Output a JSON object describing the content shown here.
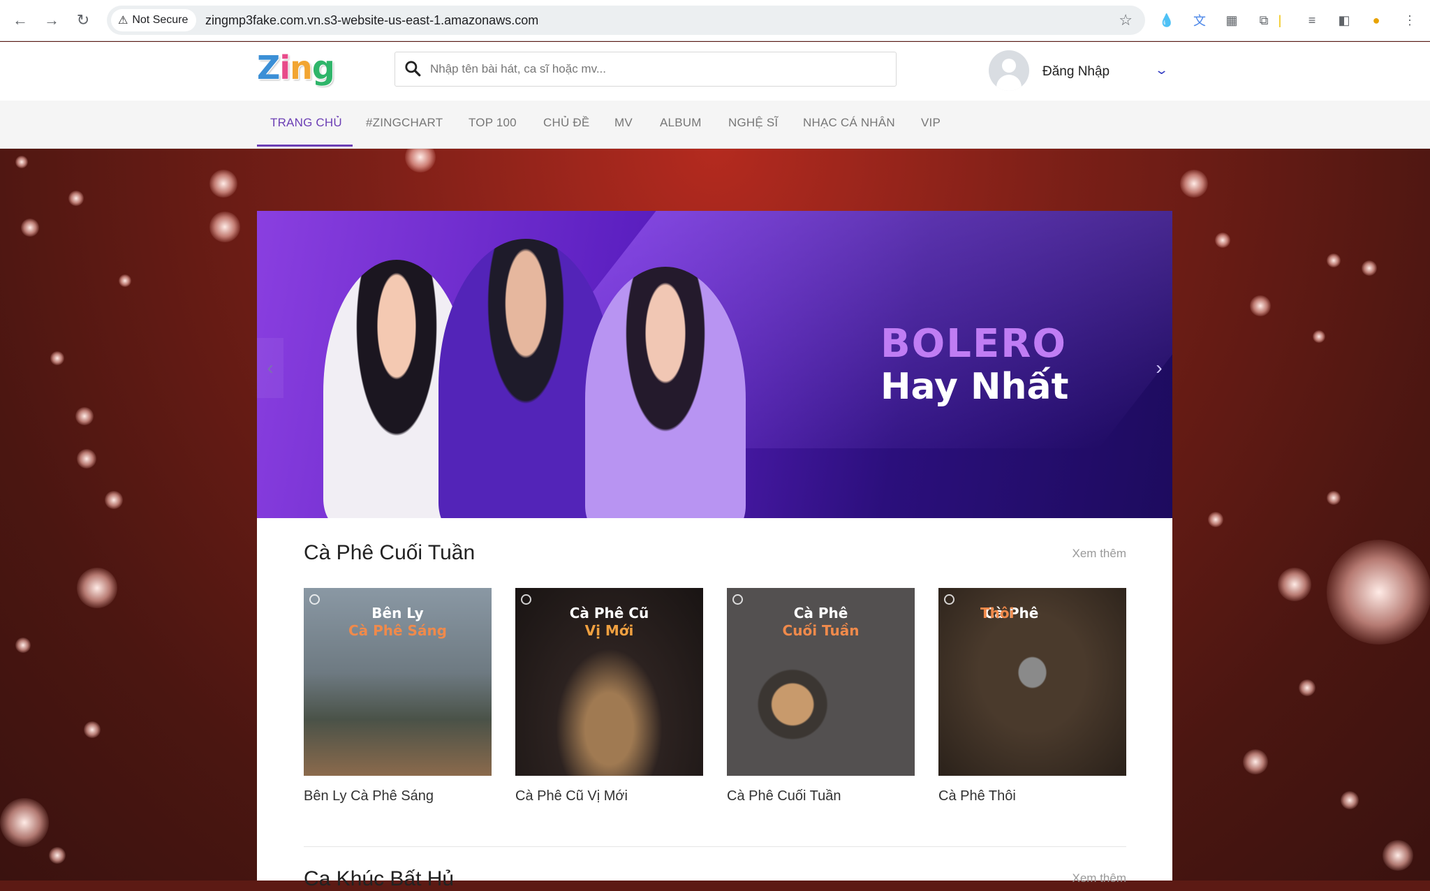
{
  "browser": {
    "security_label": "Not Secure",
    "url": "zingmp3fake.com.vn.s3-website-us-east-1.amazonaws.com",
    "icons": [
      "back-icon",
      "forward-icon",
      "reload-icon",
      "bookmark-star-icon",
      "extension-drop-icon",
      "translate-icon",
      "qr-icon",
      "puzzle-icon",
      "media-icon",
      "sidebar-icon",
      "profile-icon",
      "menu-icon"
    ]
  },
  "header": {
    "logo_letters": [
      "Z",
      "i",
      "n",
      "g"
    ],
    "logo_colors": [
      "#3b8fd6",
      "#e84b8a",
      "#f2a532",
      "#2fb56a"
    ],
    "search_placeholder": "Nhập tên bài hát, ca sĩ hoặc mv...",
    "login_label": "Đăng Nhập"
  },
  "menu": {
    "items": [
      "TRANG CHỦ",
      "#ZINGCHART",
      "TOP 100",
      "CHỦ ĐỀ",
      "MV",
      "ALBUM",
      "NGHỆ SĨ",
      "NHẠC CÁ NHÂN",
      "VIP"
    ],
    "active_index": 0,
    "accent": "#6c3fb5"
  },
  "banner": {
    "title": "BOLERO",
    "subtitle": "Hay Nhất"
  },
  "section": {
    "title": "Cà Phê Cuối Tuần",
    "more_label": "Xem thêm",
    "cards": [
      {
        "cap1": "Bên Ly",
        "cap2": "Cà Phê Sáng",
        "title": "Bên Ly Cà Phê Sáng"
      },
      {
        "cap1": "Cà Phê Cũ",
        "cap2": "Vị Mới",
        "title": "Cà Phê Cũ Vị Mới"
      },
      {
        "cap1": "Cà Phê",
        "cap2": "Cuối Tuần",
        "title": "Cà Phê Cuối Tuần"
      },
      {
        "cap1": "Cà Phê",
        "cap2": "Thôi",
        "title": "Cà Phê Thôi"
      }
    ]
  },
  "next_section": {
    "title": "Ca Khúc Bất Hủ",
    "more_label": "Xem thêm"
  }
}
